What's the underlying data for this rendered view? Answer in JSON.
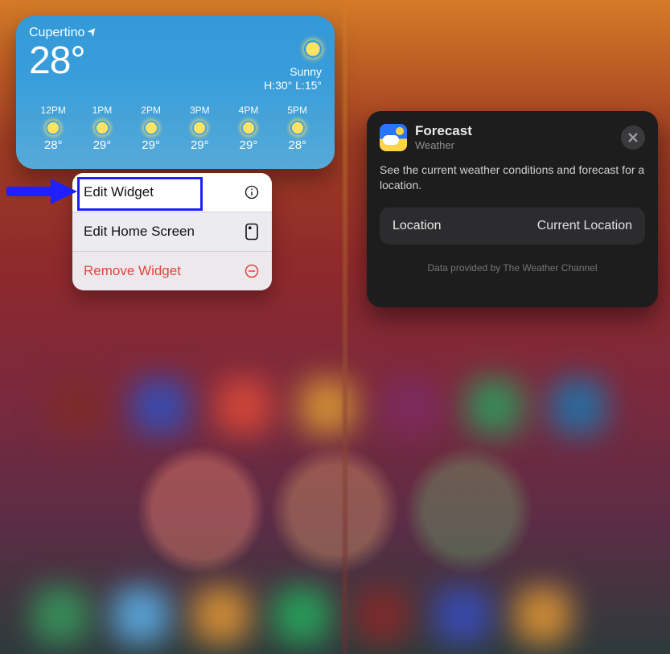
{
  "weather": {
    "location": "Cupertino",
    "current_temp": "28°",
    "condition": "Sunny",
    "hilo": "H:30° L:15°",
    "hours": [
      {
        "time": "12PM",
        "temp": "28°"
      },
      {
        "time": "1PM",
        "temp": "29°"
      },
      {
        "time": "2PM",
        "temp": "29°"
      },
      {
        "time": "3PM",
        "temp": "29°"
      },
      {
        "time": "4PM",
        "temp": "29°"
      },
      {
        "time": "5PM",
        "temp": "28°"
      }
    ]
  },
  "context_menu": {
    "edit_widget": "Edit Widget",
    "edit_home": "Edit Home Screen",
    "remove": "Remove Widget"
  },
  "forecast_sheet": {
    "title": "Forecast",
    "subtitle": "Weather",
    "description": "See the current weather conditions and forecast for a location.",
    "field_label": "Location",
    "field_value": "Current Location",
    "attribution": "Data provided by The Weather Channel"
  }
}
